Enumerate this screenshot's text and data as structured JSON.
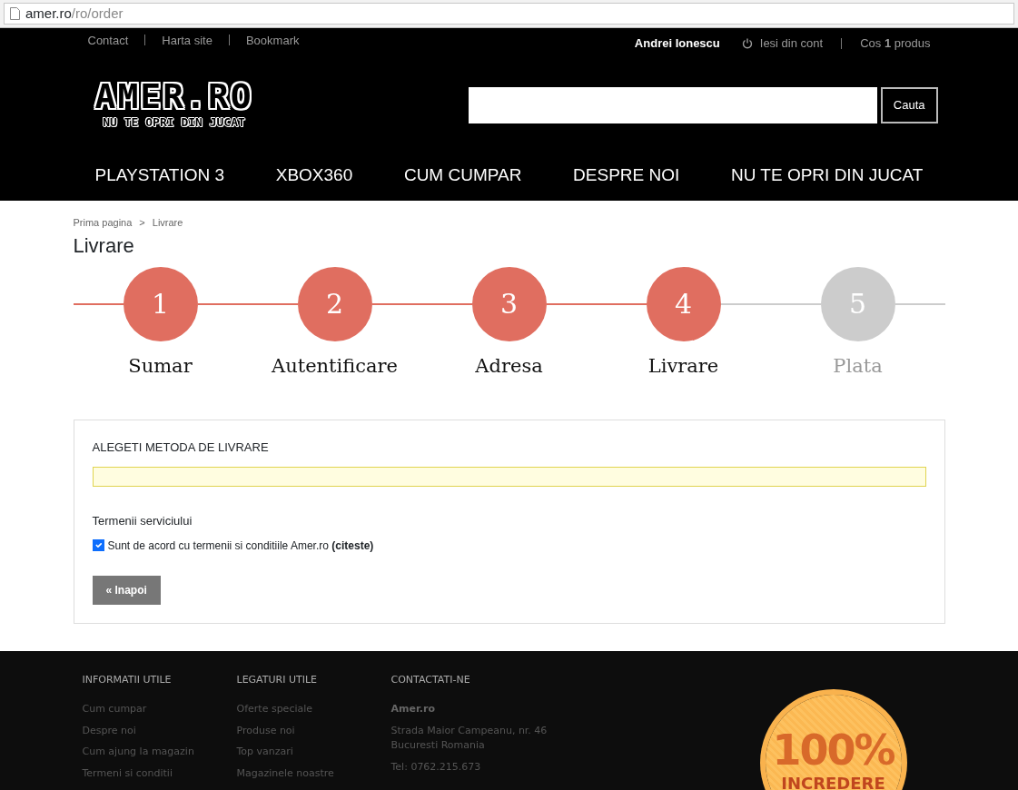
{
  "browser": {
    "url_host": "amer.ro",
    "url_path": "/ro/order"
  },
  "top_links": [
    "Contact",
    "Harta site",
    "Bookmark"
  ],
  "account": {
    "user": "Andrei Ionescu",
    "logout": "Iesi din cont",
    "cart": "Cos **1** produs"
  },
  "logo": {
    "title": "AMER.RO",
    "tagline": "NU TE OPRI DIN JUCAT"
  },
  "search": {
    "button": "Cauta"
  },
  "nav": [
    "PLAYSTATION 3",
    "XBOX360",
    "CUM CUMPAR",
    "DESPRE NOI",
    "NU TE OPRI DIN JUCAT"
  ],
  "breadcrumb": [
    "Prima pagina",
    "Livrare"
  ],
  "breadcrumb_separator": ">",
  "page_title": "Livrare",
  "steps": [
    {
      "number": "1",
      "label": "Sumar",
      "done": true
    },
    {
      "number": "2",
      "label": "Autentificare",
      "done": true
    },
    {
      "number": "3",
      "label": "Adresa",
      "done": true
    },
    {
      "number": "4",
      "label": "Livrare",
      "done": true
    },
    {
      "number": "5",
      "label": "Plata",
      "done": false
    }
  ],
  "delivery": {
    "heading": "ALEGETI METODA DE LIVRARE",
    "terms_heading": "Termenii serviciului",
    "terms_text": "Sunt de acord cu termenii si conditiile Amer.ro **(citeste)**",
    "terms_checked": true,
    "back_button": "« Inapoi"
  },
  "footer": {
    "columns": [
      {
        "heading": "INFORMATII UTILE",
        "links": [
          "Cum cumpar",
          "Despre noi",
          "Cum ajung la magazin",
          "Termeni si conditii"
        ]
      },
      {
        "heading": "LEGATURI UTILE",
        "links": [
          "Oferte speciale",
          "Produse noi",
          "Top vanzari",
          "Magazinele noastre"
        ]
      }
    ],
    "contact": {
      "heading": "CONTACTATI-NE",
      "company": "Amer.ro",
      "address": "Strada Maior Campeanu, nr. 46 Bucuresti Romania",
      "phone": "Tel: 0762.215.673"
    },
    "badge": {
      "big": "100%",
      "small": "INCREDERE"
    }
  }
}
